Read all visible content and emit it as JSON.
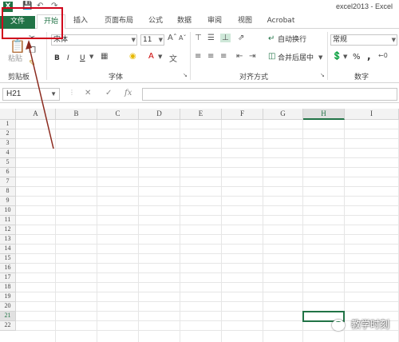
{
  "window": {
    "title": "excel2013 - Excel",
    "app_logo": "X"
  },
  "tabs": [
    {
      "label": "文件"
    },
    {
      "label": "开始"
    },
    {
      "label": "插入"
    },
    {
      "label": "页面布局"
    },
    {
      "label": "公式"
    },
    {
      "label": "数据"
    },
    {
      "label": "审阅"
    },
    {
      "label": "视图"
    },
    {
      "label": "Acrobat"
    }
  ],
  "ribbon": {
    "clipboard": {
      "label": "剪贴板",
      "paste_label": "粘贴"
    },
    "font": {
      "label": "字体",
      "font_name": "宋体",
      "font_size": "11",
      "bold": "B",
      "italic": "I",
      "underline": "U"
    },
    "alignment": {
      "label": "对齐方式",
      "wrap_text": "自动换行",
      "merge_center": "合并后居中"
    },
    "number": {
      "label": "数字",
      "format": "常规",
      "percent": "%",
      "comma": ","
    }
  },
  "formula_bar": {
    "name_box": "H21",
    "cancel": "✕",
    "enter": "✓",
    "fx": "fx",
    "value": ""
  },
  "grid": {
    "columns": [
      "A",
      "B",
      "C",
      "D",
      "E",
      "F",
      "G",
      "H",
      "I"
    ],
    "rows": [
      "1",
      "2",
      "3",
      "4",
      "5",
      "6",
      "7",
      "8",
      "9",
      "10",
      "11",
      "12",
      "13",
      "14",
      "15",
      "16",
      "17",
      "18",
      "19",
      "20",
      "21",
      "22"
    ],
    "active_column": "H",
    "active_row": "21"
  },
  "watermark": {
    "text": "教学时刻"
  },
  "colors": {
    "accent": "#217346",
    "highlight": "#d0021b"
  }
}
